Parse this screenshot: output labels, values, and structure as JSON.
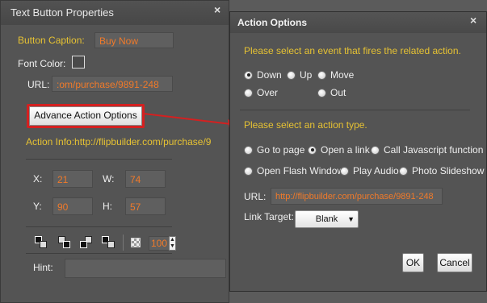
{
  "left_dialog": {
    "title": "Text Button Properties",
    "close": "×",
    "button_caption_label": "Button Caption:",
    "button_caption_value": "Buy Now",
    "font_color_label": "Font Color:",
    "url_label": "URL:",
    "url_value": ":om/purchase/9891-248",
    "advance_button": "Advance Action Options",
    "action_info": "Action Info:http://flipbuilder.com/purchase/9",
    "x_label": "X:",
    "x_value": "21",
    "w_label": "W:",
    "w_value": "74",
    "y_label": "Y:",
    "y_value": "90",
    "h_label": "H:",
    "h_value": "57",
    "opacity_value": "100",
    "hint_label": "Hint:"
  },
  "right_dialog": {
    "title": "Action Options",
    "close": "×",
    "event_prompt": "Please select an event that fires the related action.",
    "events": [
      {
        "label": "Down",
        "selected": true
      },
      {
        "label": "Up",
        "selected": false
      },
      {
        "label": "Move",
        "selected": false
      },
      {
        "label": "Over",
        "selected": false
      },
      {
        "label": "Out",
        "selected": false
      }
    ],
    "action_prompt": "Please select an action type.",
    "actions": [
      {
        "label": "Go to page",
        "selected": false
      },
      {
        "label": "Open a link",
        "selected": true
      },
      {
        "label": "Call Javascript function",
        "selected": false
      },
      {
        "label": "Open Flash Window",
        "selected": false
      },
      {
        "label": "Play Audio",
        "selected": false
      },
      {
        "label": "Photo Slideshow",
        "selected": false
      }
    ],
    "url_label": "URL:",
    "url_value": "http://flipbuilder.com/purchase/9891-248",
    "link_target_label": "Link Target:",
    "link_target_value": "Blank",
    "ok": "OK",
    "cancel": "Cancel"
  },
  "colors": {
    "accent_yellow": "#e6c233",
    "value_orange": "#f07a2a",
    "highlight_red": "#d42020",
    "dialog_bg": "#545454"
  }
}
